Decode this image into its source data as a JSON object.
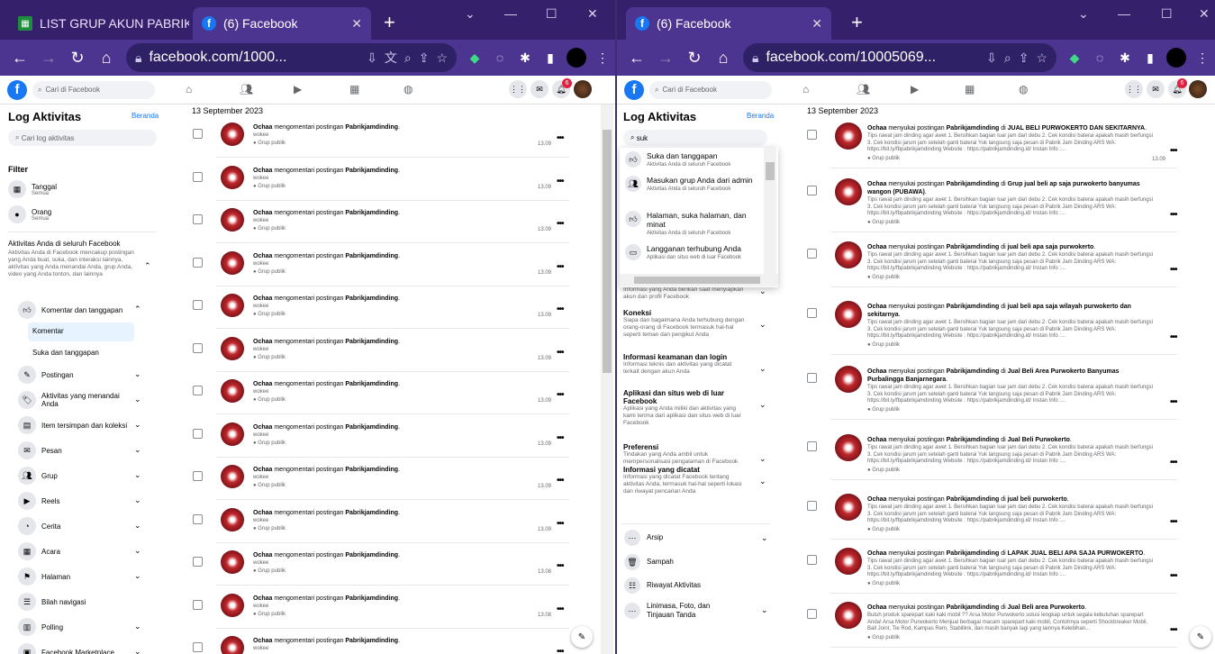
{
  "left": {
    "tabs": [
      {
        "label": "LIST GRUP AKUN PABRIK..."
      },
      {
        "label": "(6) Facebook"
      }
    ],
    "url": "facebook.com/1000...",
    "fb_search": "Cari di Facebook",
    "notif_count": "6",
    "sidebar": {
      "title": "Log Aktivitas",
      "home": "Beranda",
      "search": "Cari log aktivitas",
      "filter": "Filter",
      "filters": [
        {
          "label": "Tanggal",
          "sub": "Semua"
        },
        {
          "label": "Orang",
          "sub": "Semua"
        }
      ],
      "section_title": "Aktivitas Anda di seluruh Facebook",
      "section_desc": "Aktivitas Anda di Facebook mencakup postingan yang Anda buat, suka, dan interaksi lainnya, aktivitas yang Anda menandai Anda, grup Anda, video yang Anda tonton, dan lainnya",
      "expanded": "Komentar dan tanggapan",
      "sub_items": [
        "Komentar",
        "Suka dan tanggapan"
      ],
      "items": [
        "Postingan",
        "Aktivitas yang menandai Anda",
        "Item tersimpan dan koleksi",
        "Pesan",
        "Grup",
        "Reels",
        "Cerita",
        "Acara",
        "Halaman",
        "Bilah navigasi",
        "Polling",
        "Facebook Marketplace"
      ]
    },
    "date": "13 September 2023",
    "entry": {
      "user": "Ochaa",
      "action": " mengomentari postingan ",
      "target": "Pabrikjamdinding",
      "comment": "wokee",
      "audience": "Grup publik"
    },
    "times": [
      "13.09",
      "13.09",
      "13.09",
      "13.09",
      "13.09",
      "13.09",
      "13.09",
      "13.09",
      "13.09",
      "13.09",
      "13.08",
      "13.08",
      "13.08"
    ]
  },
  "right": {
    "tab": "(6) Facebook",
    "url": "facebook.com/10005069...",
    "fb_search": "Cari di Facebook",
    "notif_count": "6",
    "sidebar": {
      "title": "Log Aktivitas",
      "home": "Beranda",
      "search_value": "suk",
      "suggestions": [
        {
          "title": "Suka dan tanggapan",
          "sub": "Aktivitas Anda di seluruh Facebook"
        },
        {
          "title": "Masukan grup Anda dari admin",
          "sub": "Aktivitas Anda di seluruh Facebook"
        },
        {
          "title": "Halaman, suka halaman, dan minat",
          "sub": "Aktivitas Anda di seluruh Facebook"
        },
        {
          "title": "Langganan terhubung Anda",
          "sub": "Aplikasi dan situs web di luar Facebook"
        }
      ],
      "sections": [
        {
          "title": "",
          "desc": "Informasi yang Anda berikan saat menyiapkan akun dan profil Facebook"
        },
        {
          "title": "Koneksi",
          "desc": "Siapa dan bagaimana Anda terhubung dengan orang-orang di Facebook termasuk hal-hal seperti teman dan pengikut Anda"
        },
        {
          "title": "Informasi keamanan dan login",
          "desc": "Informasi teknis dan aktivitas yang dicatat terkait dengan akun Anda"
        },
        {
          "title": "Aplikasi dan situs web di luar Facebook",
          "desc": "Aplikasi yang Anda miliki dan aktivitas yang kami terima dari aplikasi dan situs web di luar Facebook"
        },
        {
          "title": "Preferensi",
          "desc": "Tindakan yang Anda ambil untuk mempersonalisasi pengalaman di Facebook"
        },
        {
          "title": "Informasi yang dicatat",
          "desc": "Informasi yang dicatat Facebook tentang aktivitas Anda, termasuk hal-hal seperti lokasi dan riwayat pencarian Anda"
        }
      ],
      "bottom": [
        "Arsip",
        "Sampah",
        "Riwayat Aktivitas",
        "Linimasa, Foto, dan Tinjauan Tanda"
      ]
    },
    "date": "13 September 2023",
    "user": "Ochaa",
    "action": " menyukai postingan ",
    "target": "Pabrikjamdinding",
    "audience": "Grup publik",
    "desc1": "Tips rawat jam dinding agar awet 1. Bersihkan bagian luar jam dari debu 2. Cek kondisi baterai apakah masih berfungsi 3. Cek kondisi jarum jam setelah ganti baterai Yuk langsung saja pesan di Pabrik Jam Dinding ARS WA: https://bit.ly/fbpabrikjamdinding Website : https://pabrikjamdinding.id/ Instan Info :...",
    "desc_last": "Butuh produk sparepart kaki kaki mobil ?? Arsa Motor Purwokerto solusi lengkap untuk segala kebutuhan sparepart Anda! Arsa Motor Purwokerto Menjual berbagai macam sparepart kaki mobil, Contohnya seperti Shockbreaker Mobil, Ball Joint, Tie Rod, Kampas Rem, Stabillink, dan masih banyak lagi yang lainnya Kelebihan...",
    "entries": [
      {
        "group": "JUAL BELI PURWOKERTO DAN SEKITARNYA",
        "time": "13.09"
      },
      {
        "group": "Grup jual beli ap saja purwokerto banyumas wangon (PUBAWA)",
        "time": ""
      },
      {
        "group": "jual beli apa saja purwokerto",
        "time": ""
      },
      {
        "group": "jual beli apa saja wilayah purwokerto dan sekitarnya",
        "time": ""
      },
      {
        "group": "Jual Beli Area Purwokerto Banyumas Purbalingga Banjarnegara",
        "time": ""
      },
      {
        "group": "Jual Beli Purwokerto",
        "time": ""
      },
      {
        "group": "jual beli purwokerto",
        "time": ""
      },
      {
        "group": "LAPAK JUAL BELI APA SAJA PURWOKERTO",
        "time": ""
      },
      {
        "group": "Jual Beli area Purwokerto",
        "time": ""
      }
    ]
  }
}
